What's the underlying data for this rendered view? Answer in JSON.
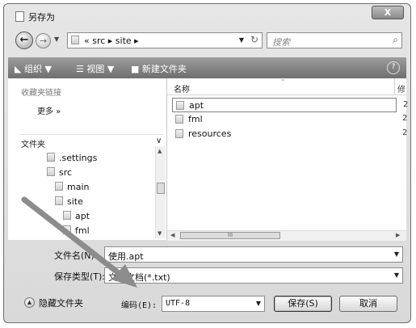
{
  "window": {
    "title": "另存为",
    "close_label": "X"
  },
  "address": {
    "path": "« src ▸ site ▸",
    "search_placeholder": "搜索"
  },
  "toolbar": {
    "organize": "组织 ▼",
    "views": "视图 ▼",
    "new_folder": "新建文件夹"
  },
  "left_pane": {
    "favorites_header": "收藏夹链接",
    "more": "更多 »",
    "folders_header": "文件夹",
    "tree": [
      ".settings",
      "src",
      "main",
      "site",
      "apt",
      "fml"
    ]
  },
  "right_pane": {
    "column_name": "名称",
    "column_next": "修",
    "files": [
      {
        "name": "apt",
        "date": "2"
      },
      {
        "name": "fml",
        "date": "2"
      },
      {
        "name": "resources",
        "date": "2"
      }
    ],
    "hscroll_label": "III"
  },
  "form": {
    "filename_label": "文件名(N):",
    "filename_value": "使用.apt",
    "filetype_label": "保存类型(T):",
    "filetype_value": "文本文档(*.txt)",
    "encoding_label": "编码(E):",
    "encoding_value": "UTF-8"
  },
  "footer": {
    "hide_folders": "隐藏文件夹",
    "save": "保存(S)",
    "cancel": "取消"
  },
  "colors": {
    "toolbar": "#808080",
    "annotation_arrow": "#8c8c8c"
  }
}
